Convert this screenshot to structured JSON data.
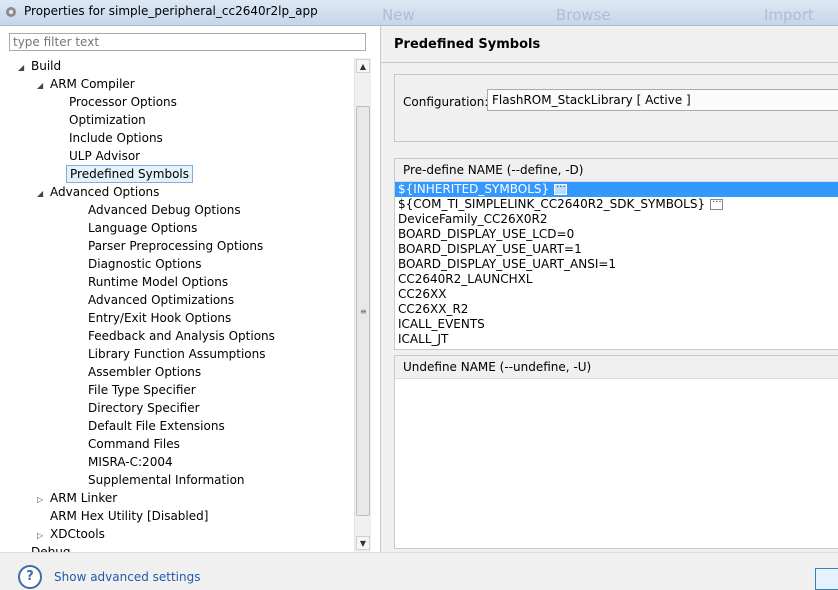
{
  "window": {
    "title": "Properties for simple_peripheral_cc2640r2lp_app",
    "background_hints": [
      "New",
      "Browse",
      "Import"
    ]
  },
  "filter": {
    "placeholder": "type filter text"
  },
  "tree": [
    {
      "label": "Build",
      "arrow": "◢"
    },
    {
      "label": "ARM Compiler",
      "arrow": "◢"
    },
    {
      "label": "Processor Options",
      "arrow": ""
    },
    {
      "label": "Optimization",
      "arrow": ""
    },
    {
      "label": "Include Options",
      "arrow": ""
    },
    {
      "label": "ULP Advisor",
      "arrow": ""
    },
    {
      "label": "Predefined Symbols",
      "arrow": "",
      "selected": true
    },
    {
      "label": "Advanced Options",
      "arrow": "◢"
    },
    {
      "label": "Advanced Debug Options",
      "arrow": ""
    },
    {
      "label": "Language Options",
      "arrow": ""
    },
    {
      "label": "Parser Preprocessing Options",
      "arrow": ""
    },
    {
      "label": "Diagnostic Options",
      "arrow": ""
    },
    {
      "label": "Runtime Model Options",
      "arrow": ""
    },
    {
      "label": "Advanced Optimizations",
      "arrow": ""
    },
    {
      "label": "Entry/Exit Hook Options",
      "arrow": ""
    },
    {
      "label": "Feedback and Analysis Options",
      "arrow": ""
    },
    {
      "label": "Library Function Assumptions",
      "arrow": ""
    },
    {
      "label": "Assembler Options",
      "arrow": ""
    },
    {
      "label": "File Type Specifier",
      "arrow": ""
    },
    {
      "label": "Directory Specifier",
      "arrow": ""
    },
    {
      "label": "Default File Extensions",
      "arrow": ""
    },
    {
      "label": "Command Files",
      "arrow": ""
    },
    {
      "label": "MISRA-C:2004",
      "arrow": ""
    },
    {
      "label": "Supplemental Information",
      "arrow": ""
    },
    {
      "label": "ARM Linker",
      "arrow": "▷"
    },
    {
      "label": "ARM Hex Utility  [Disabled]",
      "arrow": ""
    },
    {
      "label": "XDCtools",
      "arrow": "▷"
    },
    {
      "label": "Debug",
      "arrow": ""
    }
  ],
  "scrollbar": {
    "up": "▲",
    "down": "▼",
    "grip": "≡"
  },
  "page": {
    "title": "Predefined Symbols"
  },
  "configuration": {
    "label": "Configuration:",
    "value": "FlashROM_StackLibrary  [ Active ]"
  },
  "predefine": {
    "header": "Pre-define NAME (--define, -D)",
    "items": [
      {
        "text": "${INHERITED_SYMBOLS}",
        "dots": true,
        "selected": true
      },
      {
        "text": "${COM_TI_SIMPLELINK_CC2640R2_SDK_SYMBOLS}",
        "dots": true
      },
      {
        "text": "DeviceFamily_CC26X0R2"
      },
      {
        "text": "BOARD_DISPLAY_USE_LCD=0"
      },
      {
        "text": "BOARD_DISPLAY_USE_UART=1"
      },
      {
        "text": "BOARD_DISPLAY_USE_UART_ANSI=1"
      },
      {
        "text": "CC2640R2_LAUNCHXL"
      },
      {
        "text": "CC26XX"
      },
      {
        "text": "CC26XX_R2"
      },
      {
        "text": "ICALL_EVENTS"
      },
      {
        "text": "ICALL_JT"
      }
    ]
  },
  "undefine": {
    "header": "Undefine NAME (--undefine, -U)"
  },
  "footer": {
    "help": "?",
    "link": "Show advanced settings"
  }
}
